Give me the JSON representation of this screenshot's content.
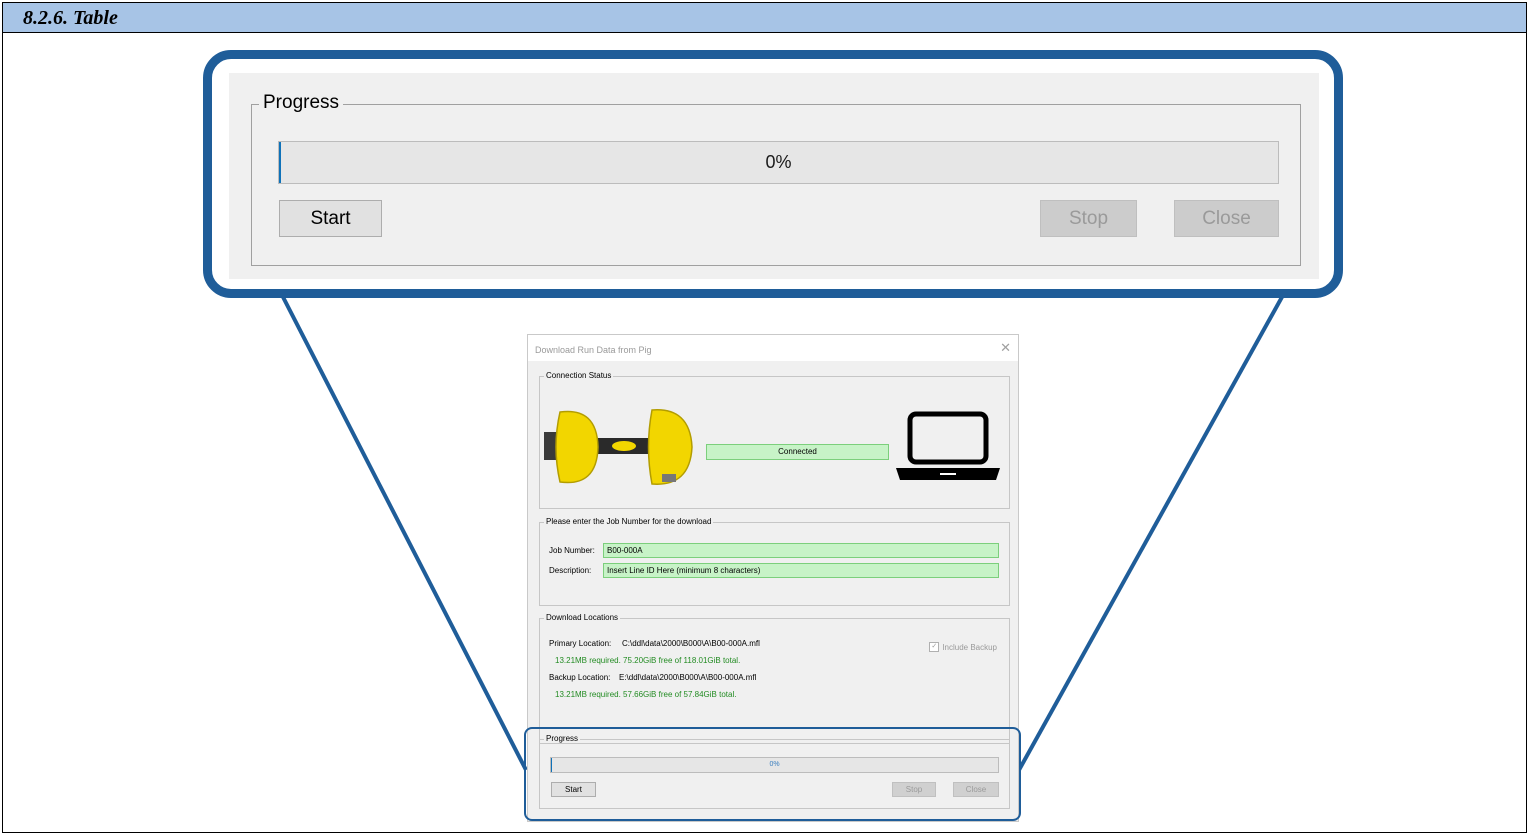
{
  "document": {
    "section_title": "8.2.6. Table"
  },
  "zoom": {
    "group_title": "Progress",
    "progress_text": "0%",
    "progress_fraction": 0.002,
    "start_label": "Start",
    "stop_label": "Stop",
    "close_label": "Close"
  },
  "dialog": {
    "title": "Download Run Data from Pig",
    "close_glyph": "✕",
    "connection": {
      "group_title": "Connection Status",
      "status": "Connected",
      "device_icon": "pig-tool-icon",
      "computer_icon": "laptop-icon"
    },
    "job": {
      "group_title": "Please enter the Job Number for the download",
      "job_label": "Job Number:",
      "job_value": "B00-000A",
      "desc_label": "Description:",
      "desc_value": "Insert Line ID Here (minimum 8 characters)"
    },
    "locations": {
      "group_title": "Download Locations",
      "primary_label": "Primary Location:",
      "primary_path": "C:\\ddl\\data\\2000\\B000\\A\\B00-000A.mfl",
      "primary_space": "13.21MB required. 75.20GiB free of 118.01GiB total.",
      "backup_label": "Backup Location:",
      "backup_path": "E:\\ddl\\data\\2000\\B000\\A\\B00-000A.mfl",
      "backup_space": "13.21MB required. 57.66GiB free of 57.84GiB total.",
      "include_backup_label": "Include Backup",
      "include_backup_checked": true
    },
    "progress": {
      "group_title": "Progress",
      "progress_text": "0%",
      "progress_fraction": 0.002,
      "start_label": "Start",
      "stop_label": "Stop",
      "close_label": "Close"
    }
  },
  "colors": {
    "header_band": "#a7c4e6",
    "callout_border": "#1f5d99",
    "field_green": "#c7f3c7",
    "space_text_green": "#228b22",
    "progress_fill": "#0f72b9"
  }
}
